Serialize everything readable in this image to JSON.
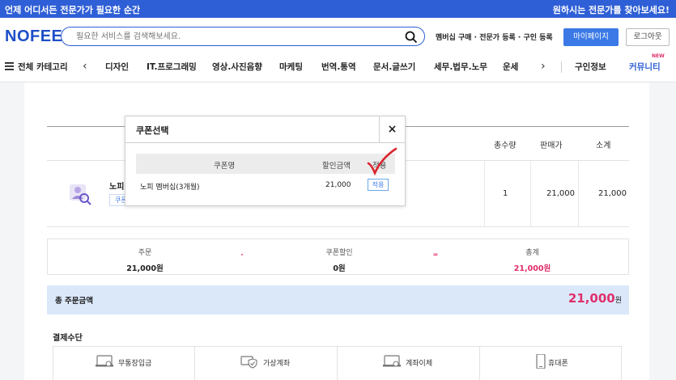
{
  "topbar": {
    "left": "언제 어디서든 전문가가 필요한 순간",
    "right": "원하시는 전문가를 찾아보세요!"
  },
  "header": {
    "logo": "NOFEE",
    "search_placeholder": "필요한 서비스를 검색해보세요.",
    "links": "멤버십 구매 · 전문가 등록 · 구인 등록",
    "mypage": "마이페이지",
    "logout": "로그아웃"
  },
  "nav": {
    "all": "전체 카테고리",
    "items": [
      "디자인",
      "IT.프로그래밍",
      "영상.사진음향",
      "마케팅",
      "번역.통역",
      "문서.글쓰기",
      "세무.법무.노무",
      "운세"
    ],
    "jobs": "구인정보",
    "community": "커뮤니티",
    "new_tag": "NEW"
  },
  "table": {
    "headers": {
      "qty": "총수량",
      "price": "판매가",
      "subtotal": "소계"
    },
    "row": {
      "name": "노피",
      "chip": "쿠폰",
      "qty": "1",
      "price": "21,000",
      "subtotal": "21,000"
    }
  },
  "summary": {
    "order_label": "주문",
    "order_value": "21,000원",
    "minus": "-",
    "coupon_label": "쿠폰할인",
    "coupon_value": "0원",
    "equals": "=",
    "total_label": "총계",
    "total_value": "21,000원"
  },
  "total_bar": {
    "label": "총 주문금액",
    "amount": "21,000",
    "unit": "원"
  },
  "payment": {
    "title": "결제수단",
    "methods": [
      "무통장입금",
      "가상계좌",
      "계좌이체",
      "휴대폰"
    ]
  },
  "modal": {
    "title": "쿠폰선택",
    "close": "×",
    "headers": {
      "name": "쿠폰명",
      "discount": "할인금액",
      "apply": "적용"
    },
    "row": {
      "name": "노피 멤버십(3개월)",
      "discount": "21,000",
      "apply": "적용"
    }
  },
  "colors": {
    "brand": "#2f5fd6",
    "accent": "#e02f6b",
    "total_bar": "#dbe8fa"
  }
}
